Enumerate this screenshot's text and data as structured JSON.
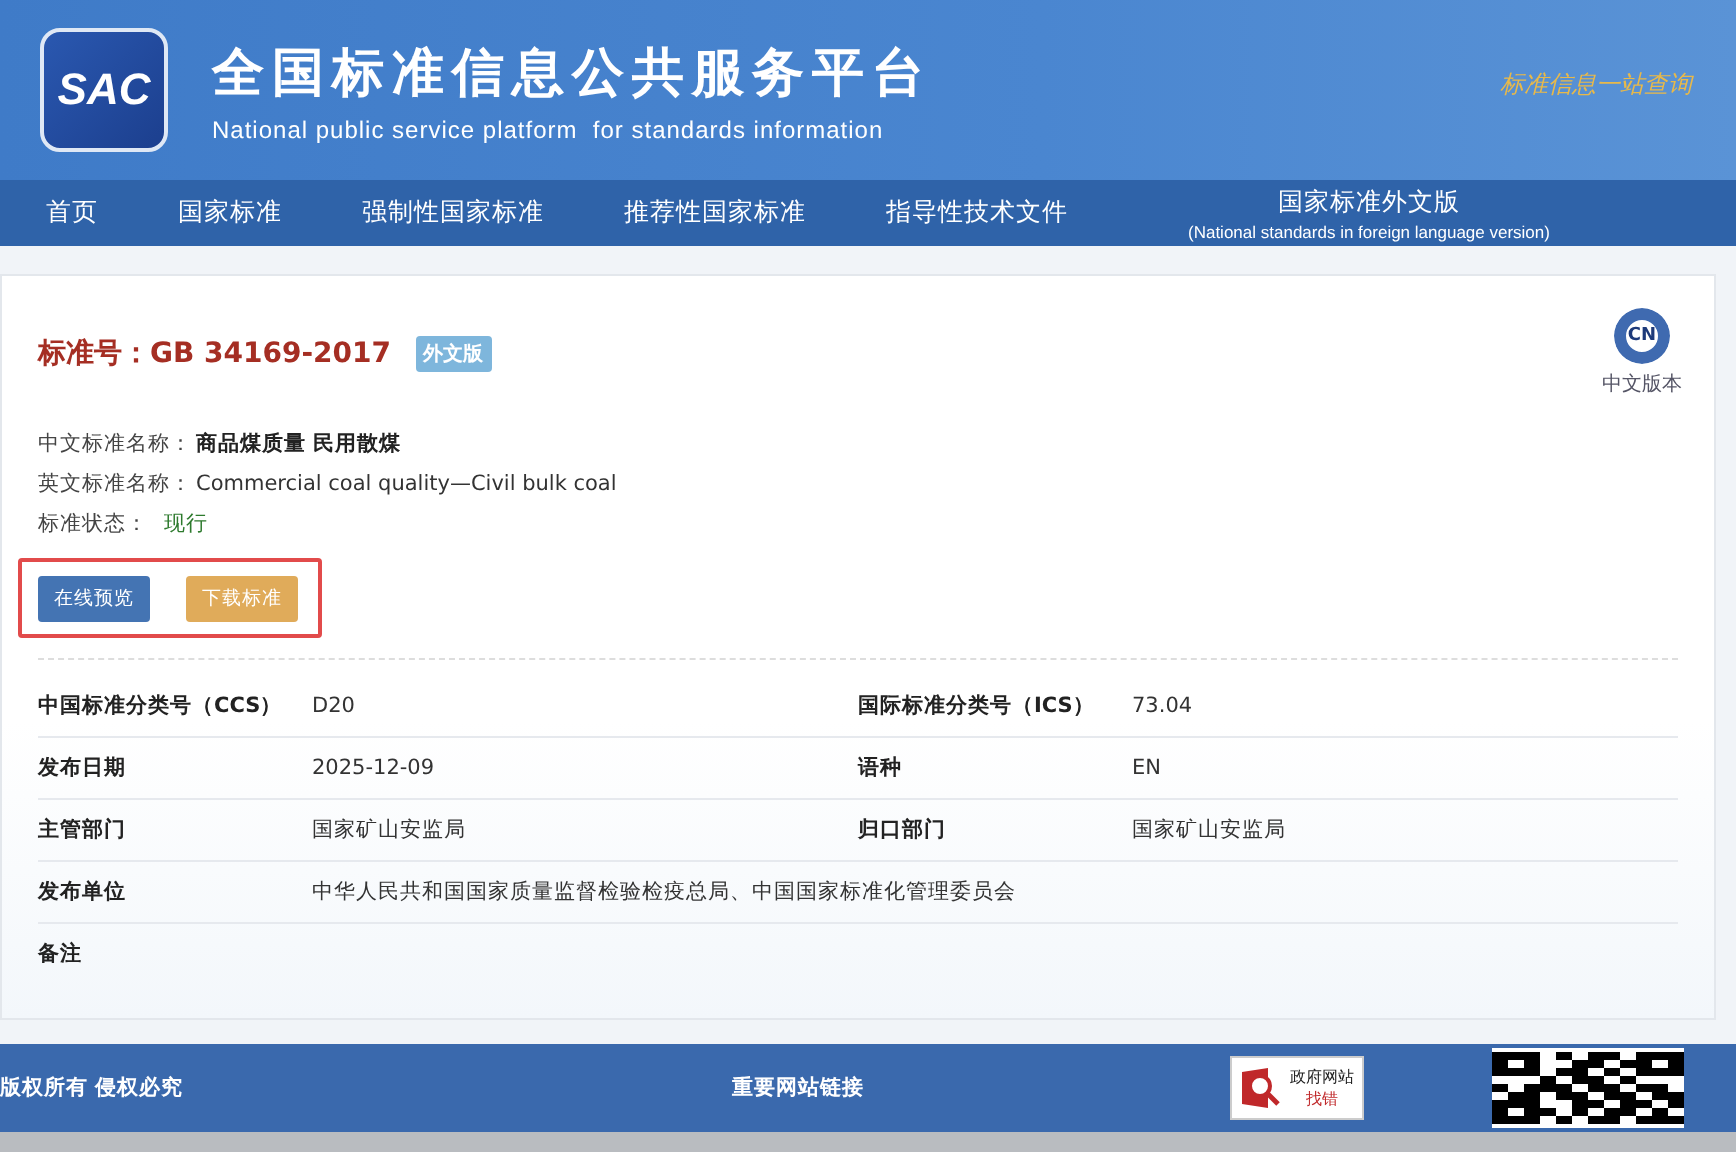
{
  "header": {
    "logo": "SAC",
    "title": "全国标准信息公共服务平台",
    "subtitle": "National public service platform  for standards information",
    "slogan": "标准信息一站查询"
  },
  "nav": [
    {
      "label": "首页",
      "selected": false
    },
    {
      "label": "国家标准",
      "selected": false
    },
    {
      "label": "强制性国家标准",
      "selected": false
    },
    {
      "label": "推荐性国家标准",
      "selected": false
    },
    {
      "label": "指导性技术文件",
      "selected": false
    },
    {
      "label": "国家标准外文版",
      "sublabel": "(National standards in foreign language version)",
      "selected": false
    }
  ],
  "standard": {
    "label": "标准号：",
    "number": "GB 34169-2017",
    "badge": "外文版",
    "lang_switch": {
      "icon_text": "CN",
      "label": "中文版本"
    },
    "fields": [
      {
        "label": "中文标准名称：",
        "value": "商品煤质量 民用散煤",
        "kind": "bold"
      },
      {
        "label": "英文标准名称：",
        "value": "Commercial coal quality—Civil bulk coal",
        "kind": "plain"
      },
      {
        "label": "标准状态：",
        "value": "现行",
        "kind": "status"
      }
    ],
    "buttons": [
      {
        "label": "在线预览",
        "kind": "primary"
      },
      {
        "label": "下载标准",
        "kind": "warning"
      }
    ]
  },
  "details": [
    [
      {
        "label": "中国标准分类号（CCS）",
        "value": "D20"
      },
      {
        "label": "国际标准分类号（ICS）",
        "value": "73.04"
      }
    ],
    [
      {
        "label": "发布日期",
        "value": "2025-12-09"
      },
      {
        "label": "语种",
        "value": "EN"
      }
    ],
    [
      {
        "label": "主管部门",
        "value": "国家矿山安监局"
      },
      {
        "label": "归口部门",
        "value": "国家矿山安监局"
      }
    ],
    [
      {
        "label": "发布单位",
        "value": "中华人民共和国国家质量监督检验检疫总局、中国国家标准化管理委员会"
      }
    ],
    [
      {
        "label": "备注"
      }
    ]
  ],
  "footer": {
    "copyright": "版权所有 侵权必究",
    "links_title": "重要网站链接",
    "gov_badge": {
      "line1": "政府网站",
      "line2": "找错"
    }
  }
}
